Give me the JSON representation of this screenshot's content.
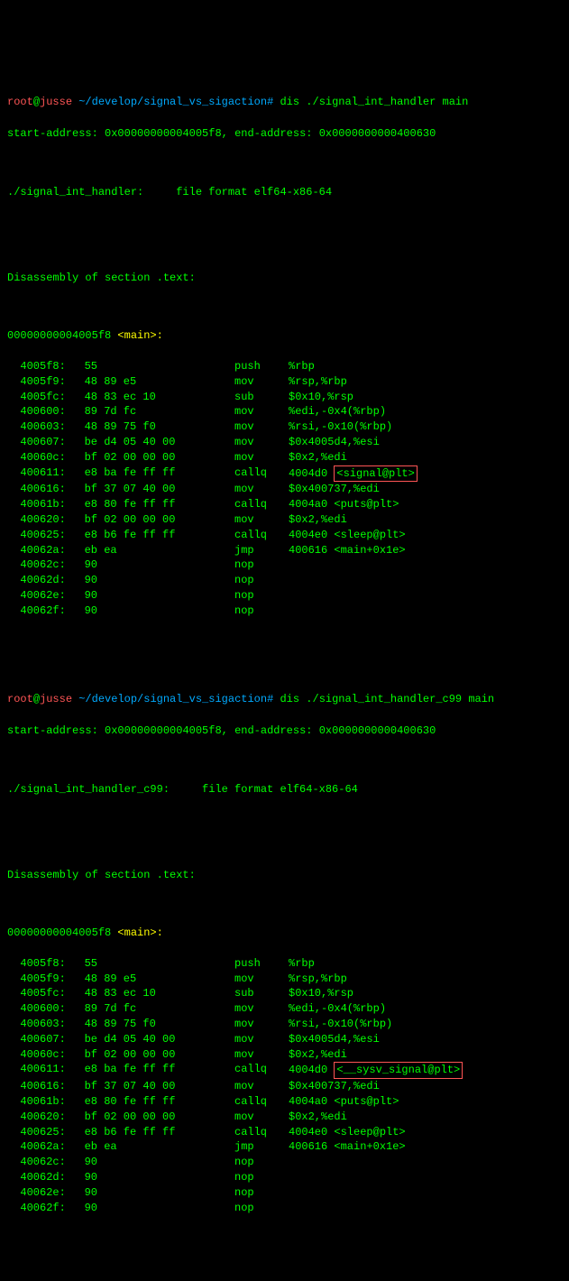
{
  "block1": {
    "prompt": {
      "user": "root",
      "at": "@",
      "host": "jusse",
      "path": "~/develop/signal_vs_sigaction",
      "hash": "#",
      "cmd": "dis ./signal_int_handler main"
    },
    "start_addr_label": "start-address:",
    "start_addr": "0x00000000004005f8,",
    "end_addr_label": "end-address:",
    "end_addr": "0x0000000000400630",
    "file_line": "./signal_int_handler:     file format elf64-x86-64",
    "disasm_header": "Disassembly of section .text:",
    "func_addr": "00000000004005f8",
    "func_name": "<main>:",
    "rows": [
      {
        "addr": "4005f8:",
        "hex": "55",
        "mnem": "push",
        "op": "%rbp"
      },
      {
        "addr": "4005f9:",
        "hex": "48 89 e5",
        "mnem": "mov",
        "op": "%rsp,%rbp"
      },
      {
        "addr": "4005fc:",
        "hex": "48 83 ec 10",
        "mnem": "sub",
        "op": "$0x10,%rsp"
      },
      {
        "addr": "400600:",
        "hex": "89 7d fc",
        "mnem": "mov",
        "op": "%edi,-0x4(%rbp)"
      },
      {
        "addr": "400603:",
        "hex": "48 89 75 f0",
        "mnem": "mov",
        "op": "%rsi,-0x10(%rbp)"
      },
      {
        "addr": "400607:",
        "hex": "be d4 05 40 00",
        "mnem": "mov",
        "op": "$0x4005d4,%esi"
      },
      {
        "addr": "40060c:",
        "hex": "bf 02 00 00 00",
        "mnem": "mov",
        "op": "$0x2,%edi"
      },
      {
        "addr": "400611:",
        "hex": "e8 ba fe ff ff",
        "mnem": "callq",
        "op": "4004d0 ",
        "box": "<signal@plt>"
      },
      {
        "addr": "400616:",
        "hex": "bf 37 07 40 00",
        "mnem": "mov",
        "op": "$0x400737,%edi"
      },
      {
        "addr": "40061b:",
        "hex": "e8 80 fe ff ff",
        "mnem": "callq",
        "op": "4004a0 <puts@plt>"
      },
      {
        "addr": "400620:",
        "hex": "bf 02 00 00 00",
        "mnem": "mov",
        "op": "$0x2,%edi"
      },
      {
        "addr": "400625:",
        "hex": "e8 b6 fe ff ff",
        "mnem": "callq",
        "op": "4004e0 <sleep@plt>"
      },
      {
        "addr": "40062a:",
        "hex": "eb ea",
        "mnem": "jmp",
        "op": "400616 <main+0x1e>"
      },
      {
        "addr": "40062c:",
        "hex": "90",
        "mnem": "nop",
        "op": ""
      },
      {
        "addr": "40062d:",
        "hex": "90",
        "mnem": "nop",
        "op": ""
      },
      {
        "addr": "40062e:",
        "hex": "90",
        "mnem": "nop",
        "op": ""
      },
      {
        "addr": "40062f:",
        "hex": "90",
        "mnem": "nop",
        "op": ""
      }
    ]
  },
  "block2": {
    "prompt": {
      "user": "root",
      "at": "@",
      "host": "jusse",
      "path": "~/develop/signal_vs_sigaction",
      "hash": "#",
      "cmd": "dis ./signal_int_handler_c99 main"
    },
    "start_addr_label": "start-address:",
    "start_addr": "0x00000000004005f8,",
    "end_addr_label": "end-address:",
    "end_addr": "0x0000000000400630",
    "file_line": "./signal_int_handler_c99:     file format elf64-x86-64",
    "disasm_header": "Disassembly of section .text:",
    "func_addr": "00000000004005f8",
    "func_name": "<main>:",
    "rows": [
      {
        "addr": "4005f8:",
        "hex": "55",
        "mnem": "push",
        "op": "%rbp"
      },
      {
        "addr": "4005f9:",
        "hex": "48 89 e5",
        "mnem": "mov",
        "op": "%rsp,%rbp"
      },
      {
        "addr": "4005fc:",
        "hex": "48 83 ec 10",
        "mnem": "sub",
        "op": "$0x10,%rsp"
      },
      {
        "addr": "400600:",
        "hex": "89 7d fc",
        "mnem": "mov",
        "op": "%edi,-0x4(%rbp)"
      },
      {
        "addr": "400603:",
        "hex": "48 89 75 f0",
        "mnem": "mov",
        "op": "%rsi,-0x10(%rbp)"
      },
      {
        "addr": "400607:",
        "hex": "be d4 05 40 00",
        "mnem": "mov",
        "op": "$0x4005d4,%esi"
      },
      {
        "addr": "40060c:",
        "hex": "bf 02 00 00 00",
        "mnem": "mov",
        "op": "$0x2,%edi"
      },
      {
        "addr": "400611:",
        "hex": "e8 ba fe ff ff",
        "mnem": "callq",
        "op": "4004d0 ",
        "box": "<__sysv_signal@plt>"
      },
      {
        "addr": "400616:",
        "hex": "bf 37 07 40 00",
        "mnem": "mov",
        "op": "$0x400737,%edi"
      },
      {
        "addr": "40061b:",
        "hex": "e8 80 fe ff ff",
        "mnem": "callq",
        "op": "4004a0 <puts@plt>"
      },
      {
        "addr": "400620:",
        "hex": "bf 02 00 00 00",
        "mnem": "mov",
        "op": "$0x2,%edi"
      },
      {
        "addr": "400625:",
        "hex": "e8 b6 fe ff ff",
        "mnem": "callq",
        "op": "4004e0 <sleep@plt>"
      },
      {
        "addr": "40062a:",
        "hex": "eb ea",
        "mnem": "jmp",
        "op": "400616 <main+0x1e>"
      },
      {
        "addr": "40062c:",
        "hex": "90",
        "mnem": "nop",
        "op": ""
      },
      {
        "addr": "40062d:",
        "hex": "90",
        "mnem": "nop",
        "op": ""
      },
      {
        "addr": "40062e:",
        "hex": "90",
        "mnem": "nop",
        "op": ""
      },
      {
        "addr": "40062f:",
        "hex": "90",
        "mnem": "nop",
        "op": ""
      }
    ]
  }
}
